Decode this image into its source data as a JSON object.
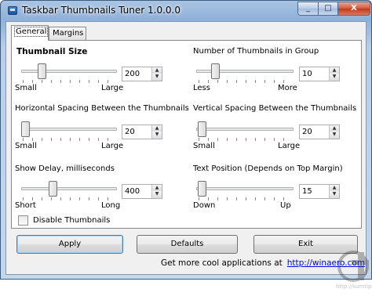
{
  "window": {
    "title": "Taskbar Thumbnails Tuner 1.0.0.0",
    "minimize_glyph": "_",
    "maximize_glyph": "□",
    "close_glyph": "X"
  },
  "tabs": [
    {
      "label": "General",
      "active": true
    },
    {
      "label": "Margins",
      "active": false
    }
  ],
  "settings": {
    "thumbnail_size": {
      "label": "Thumbnail Size",
      "min_label": "Small",
      "max_label": "Large",
      "value": "200"
    },
    "thumbnails_in_group": {
      "label": "Number of Thumbnails in Group",
      "min_label": "Less",
      "max_label": "More",
      "value": "10"
    },
    "horizontal_spacing": {
      "label": "Horizontal Spacing Between the Thumbnails",
      "min_label": "Small",
      "max_label": "Large",
      "value": "20"
    },
    "vertical_spacing": {
      "label": "Vertical Spacing Between the Thumbnails",
      "min_label": "Small",
      "max_label": "Large",
      "value": "20"
    },
    "show_delay": {
      "label": "Show Delay, milliseconds",
      "min_label": "Short",
      "max_label": "Long",
      "value": "400"
    },
    "text_position": {
      "label": "Text Position (Depends on Top Margin)",
      "min_label": "Down",
      "max_label": "Up",
      "value": "15"
    }
  },
  "disable_thumbnails": {
    "label": "Disable Thumbnails",
    "checked": false
  },
  "buttons": {
    "apply": "Apply",
    "defaults": "Defaults",
    "exit": "Exit"
  },
  "footer": {
    "text": "Get more cool applications at",
    "link": "http://winaero.com"
  },
  "watermark": {
    "text": "http://sumtips.com"
  },
  "spin_up_glyph": "▲",
  "spin_down_glyph": "▼",
  "colors": {
    "link": "#0000ee",
    "title_bar": "#8fb0d8",
    "close_button": "#c43718"
  }
}
